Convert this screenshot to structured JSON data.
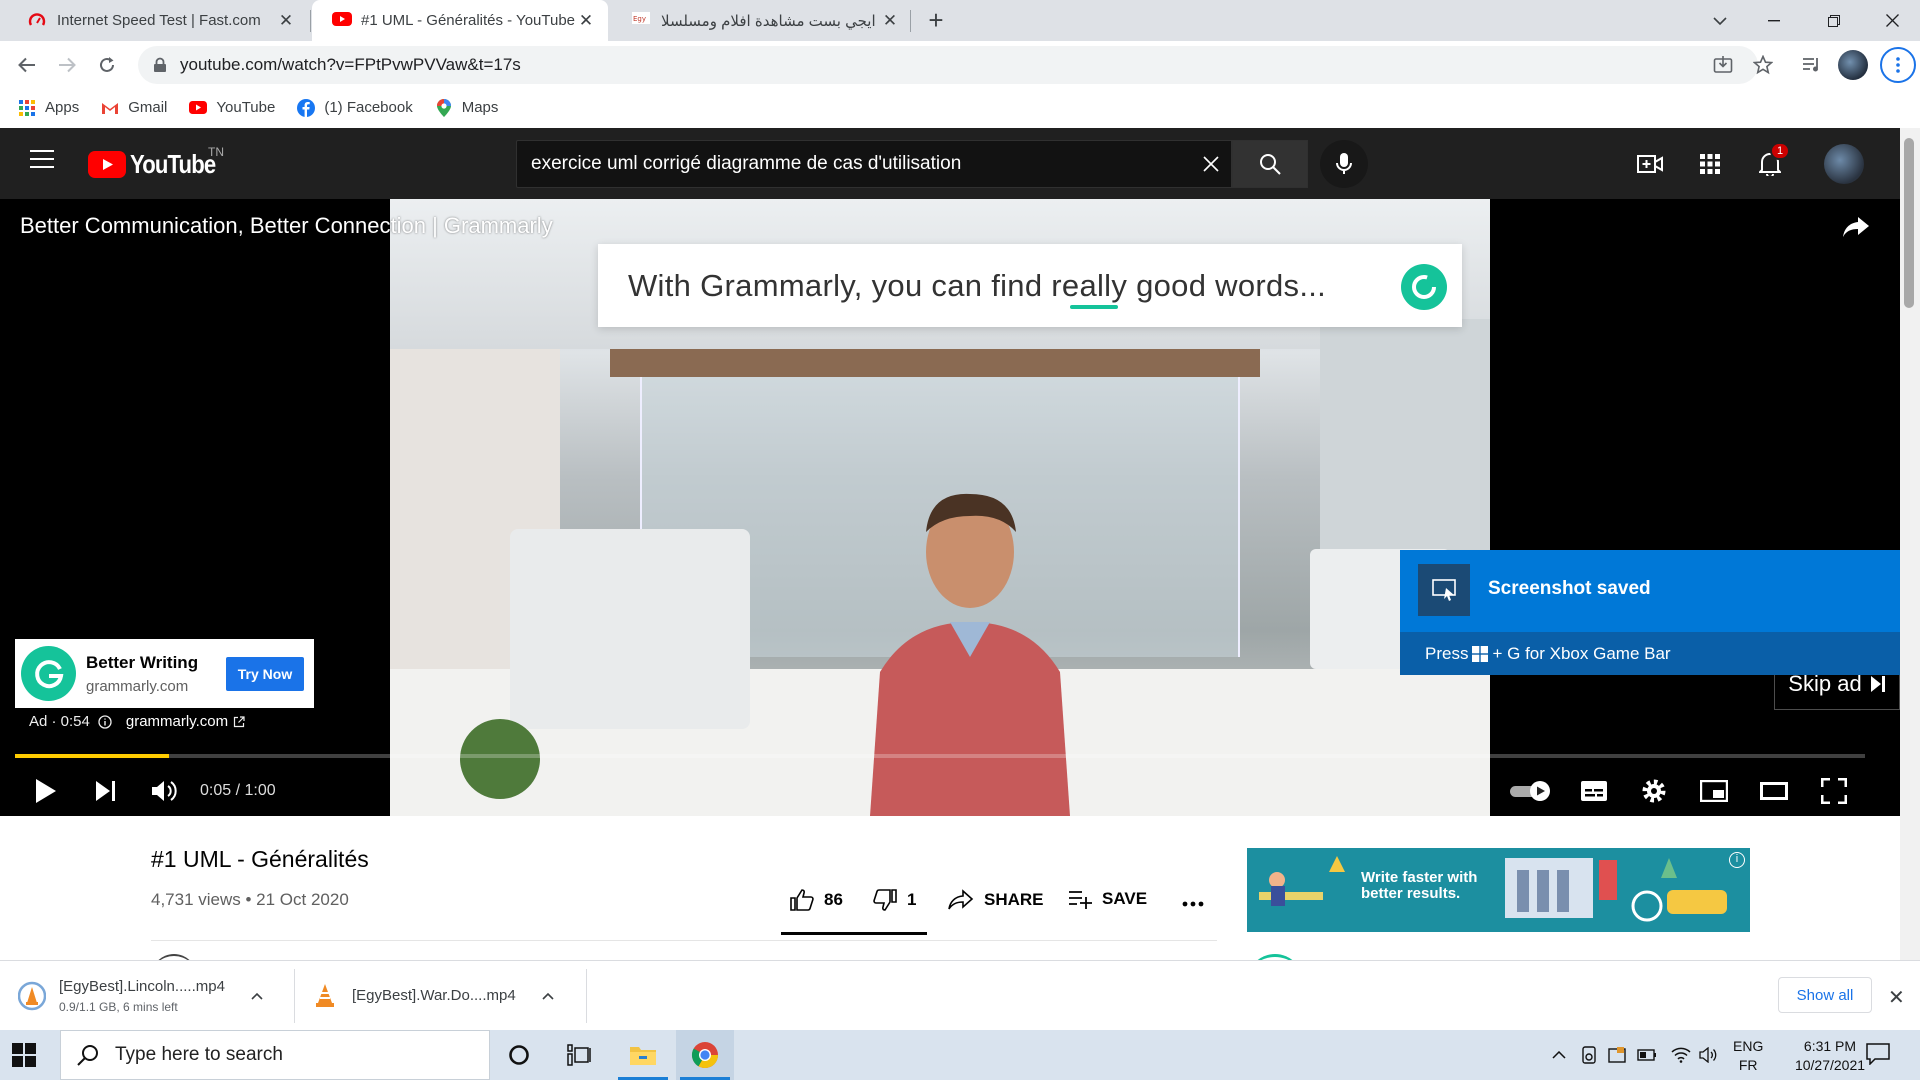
{
  "browser": {
    "tabs": [
      {
        "title": "Internet Speed Test | Fast.com",
        "icon": "fast-com-icon"
      },
      {
        "title": "#1 UML - Généralités - YouTube",
        "icon": "youtube-icon"
      },
      {
        "title": "ايجي بست مشاهدة افلام ومسلسلا",
        "icon": "egybest-icon"
      }
    ],
    "url": "youtube.com/watch?v=FPtPvwPVVaw&t=17s",
    "bookmarks": [
      {
        "label": "Apps",
        "icon": "apps-grid-icon"
      },
      {
        "label": "Gmail",
        "icon": "gmail-icon"
      },
      {
        "label": "YouTube",
        "icon": "youtube-icon"
      },
      {
        "label": "(1) Facebook",
        "icon": "facebook-icon"
      },
      {
        "label": "Maps",
        "icon": "maps-icon"
      }
    ]
  },
  "youtube": {
    "logo_text": "YouTube",
    "country_code": "TN",
    "search_query": "exercice uml corrigé diagramme de cas d'utilisation",
    "notification_count": "1",
    "player": {
      "ad_title": "Better Communication, Better Connection | Grammarly",
      "ad_overlay_text": "With Grammarly, you can find really good words...",
      "ad_card": {
        "title": "Better Writing",
        "domain": "grammarly.com",
        "cta": "Try Now"
      },
      "ad_meta": {
        "label": "Ad · 0:54",
        "domain": "grammarly.com"
      },
      "skip_label": "Skip ad",
      "time": "0:05 / 1:00",
      "progress_fraction": 0.0833
    },
    "video": {
      "title": "#1 UML - Généralités",
      "meta": "4,731 views • 21 Oct 2020",
      "likes": "86",
      "dislikes": "1",
      "share_label": "SHARE",
      "save_label": "SAVE"
    },
    "side_ad_text_line1": "Write faster with",
    "side_ad_text_line2": "better results."
  },
  "toast": {
    "title": "Screenshot saved",
    "message_prefix": "Press",
    "message_suffix": "+ G for Xbox Game Bar"
  },
  "downloads": [
    {
      "name": "[EgyBest].Lincoln.....mp4",
      "status": "0.9/1.1 GB, 6 mins left"
    },
    {
      "name": "[EgyBest].War.Do....mp4",
      "status": ""
    }
  ],
  "downloads_show_all": "Show all",
  "taskbar": {
    "search_placeholder": "Type here to search",
    "lang_line1": "ENG",
    "lang_line2": "FR",
    "time": "6:31 PM",
    "date": "10/27/2021"
  },
  "colors": {
    "youtube_red": "#ff0000",
    "grammarly_green": "#15c39a",
    "toast_blue": "#0078d7",
    "progress_yellow": "#ffcc00",
    "link_blue": "#1a73e8"
  }
}
